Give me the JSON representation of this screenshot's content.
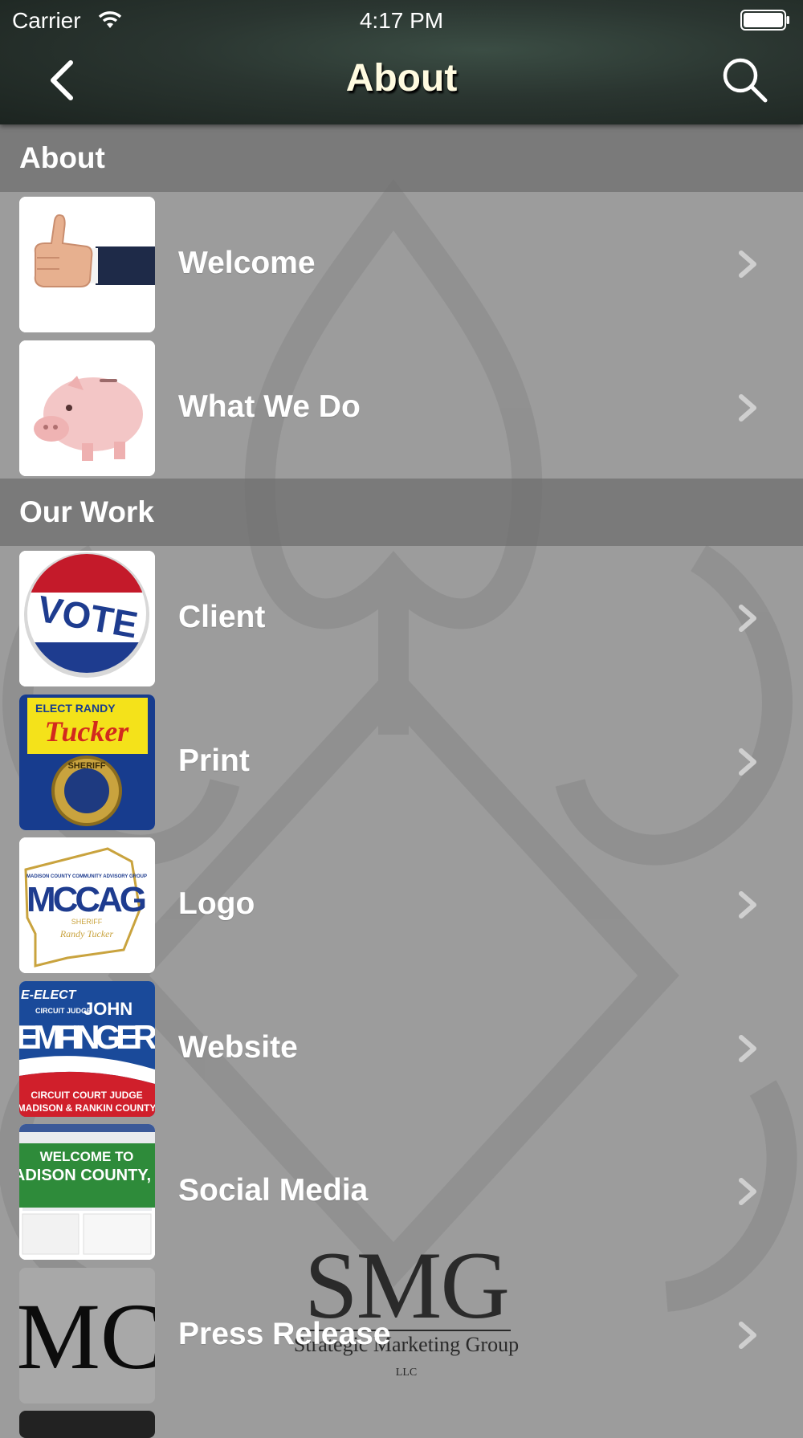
{
  "status_bar": {
    "carrier": "Carrier",
    "time": "4:17 PM"
  },
  "nav": {
    "title": "About",
    "back_icon": "chevron-left-icon",
    "search_icon": "search-icon"
  },
  "sections": [
    {
      "header": "About",
      "items": [
        {
          "label": "Welcome",
          "thumb": "thumbs-up-image"
        },
        {
          "label": "What We Do",
          "thumb": "piggy-bank-image"
        }
      ]
    },
    {
      "header": "Our Work",
      "items": [
        {
          "label": "Client",
          "thumb": "vote-button-image"
        },
        {
          "label": "Print",
          "thumb": "sheriff-campaign-image"
        },
        {
          "label": "Logo",
          "thumb": "mccag-logo-image"
        },
        {
          "label": "Website",
          "thumb": "judge-campaign-image"
        },
        {
          "label": "Social Media",
          "thumb": "facebook-page-image"
        },
        {
          "label": "Press Release",
          "thumb": "mc-letters-image"
        }
      ]
    }
  ],
  "thumb_text": {
    "vote": "VOTE",
    "elect_randy": "ELECT RANDY",
    "tucker": "Tucker",
    "sheriff": "SHERIFF",
    "mccag_top": "MADISON COUNTY COMMUNITY ADVISORY GROUP",
    "mccag": "MCCAG",
    "mccag_sheriff": "SHERIFF",
    "mccag_sign": "Randy Tucker",
    "re_elect": "E-ELECT",
    "circuit_judge": "CIRCUIT JUDGE",
    "john": "JOHN",
    "emfinger": "EMFINGER",
    "circuit_court": "CIRCUIT COURT JUDGE",
    "madison_rankin": "MADISON & RANKIN COUNTY",
    "welcome_to": "WELCOME TO",
    "madison_county": "ADISON COUNTY, I",
    "mc": "MC"
  },
  "watermark": {
    "logo": "SMG",
    "tagline": "Strategic Marketing Group",
    "suffix": "LLC"
  },
  "colors": {
    "section_header_bg": "#6e6e6e",
    "row_bg": "#9c9c9c",
    "title_text": "#fffbe0"
  }
}
